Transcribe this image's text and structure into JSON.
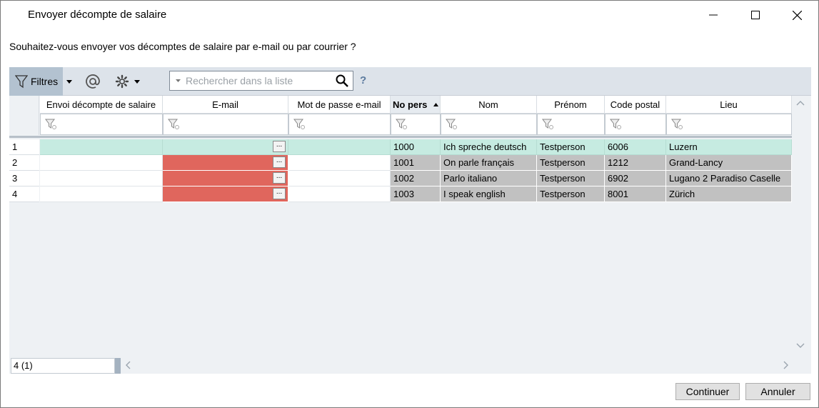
{
  "window": {
    "title": "Envoyer décompte de salaire"
  },
  "question": "Souhaitez-vous envoyer vos décomptes de salaire par e-mail ou par courrier ?",
  "toolbar": {
    "filters_label": "Filtres",
    "search_placeholder": "Rechercher dans la liste",
    "help_label": "?"
  },
  "columns": [
    "Envoi décompte de salaire",
    "E-mail",
    "Mot de passe e-mail",
    "No pers",
    "Nom",
    "Prénom",
    "Code postal",
    "Lieu"
  ],
  "rows": [
    {
      "num": "1",
      "envoi": "",
      "email": "",
      "password": "",
      "no": "1000",
      "nom": "Ich spreche deutsch",
      "prenom": "Testperson",
      "code": "6006",
      "lieu": "Luzern"
    },
    {
      "num": "2",
      "envoi": "",
      "email": "",
      "password": "",
      "no": "1001",
      "nom": "On parle français",
      "prenom": "Testperson",
      "code": "1212",
      "lieu": "Grand-Lancy"
    },
    {
      "num": "3",
      "envoi": "",
      "email": "",
      "password": "",
      "no": "1002",
      "nom": "Parlo italiano",
      "prenom": "Testperson",
      "code": "6902",
      "lieu": "Lugano 2 Paradiso Caselle"
    },
    {
      "num": "4",
      "envoi": "",
      "email": "",
      "password": "",
      "no": "1003",
      "nom": "I speak english",
      "prenom": "Testperson",
      "code": "8001",
      "lieu": "Zürich"
    }
  ],
  "ellipsis_label": "...",
  "status": {
    "count": "4 (1)"
  },
  "buttons": {
    "continue": "Continuer",
    "cancel": "Annuler"
  },
  "colors": {
    "selected_row": "#c6ebe1",
    "invalid_email": "#e0665d",
    "readonly_cell": "#c1c1c1"
  }
}
